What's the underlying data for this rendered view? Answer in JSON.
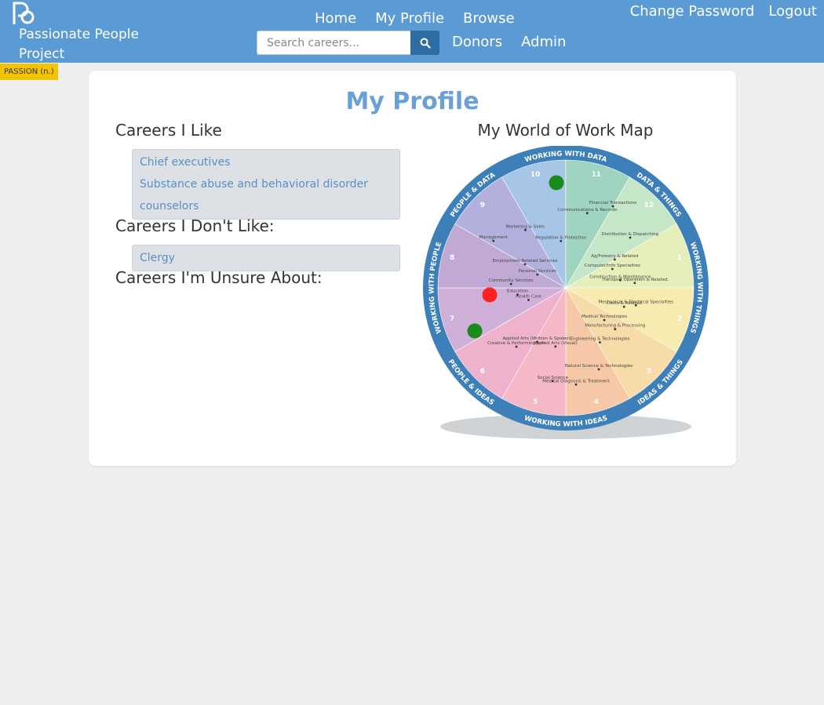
{
  "nav": {
    "brand": "Passionate People Project",
    "badge": "PASSION (n.)",
    "links_row1": [
      "Home",
      "My Profile",
      "Browse"
    ],
    "links_row2": [
      "Donors",
      "Admin"
    ],
    "right_links": [
      "Change Password",
      "Logout"
    ],
    "search_placeholder": "Search careers...",
    "colors": {
      "navbar": "#5b9bd5",
      "badge": "#f2c500",
      "search_button": "#2e6da4"
    }
  },
  "page": {
    "title": "My Profile",
    "liked_heading": "Careers I Like",
    "liked": [
      "Chief executives",
      "Substance abuse and behavioral disorder counselors"
    ],
    "disliked_heading": "Careers I Don't Like:",
    "disliked": [
      "Clergy"
    ],
    "unsure_heading": "Careers I'm Unsure About:",
    "unsure": [],
    "map_title": "My World of Work Map"
  },
  "wheel": {
    "ring_labels": [
      "WORKING WITH DATA",
      "DATA & THINGS",
      "WORKING WITH THINGS",
      "IDEAS & THINGS",
      "WORKING WITH IDEAS",
      "PEOPLE & IDEAS",
      "WORKING WITH PEOPLE",
      "PEOPLE & DATA"
    ],
    "region_numbers": [
      "1",
      "2",
      "3",
      "4",
      "5",
      "6",
      "7",
      "8",
      "9",
      "10",
      "11",
      "12"
    ],
    "career_labels": [
      "Financial Transactions",
      "Communications & Records",
      "Management",
      "Marketing & Sales",
      "Regulation & Protection",
      "Distribution & Dispatching",
      "Employment-Related Services",
      "Personal Services",
      "Transport Operation & Related",
      "Ag/Forestry & Related",
      "Computer/Info Specialties",
      "Construction & Maintenance",
      "Mechanical & Electrical Specialties",
      "Crafts & Related",
      "Community Services",
      "Education",
      "Health Care",
      "Manufacturing & Processing",
      "Medical Technologies",
      "Engineering & Technologies",
      "Applied Arts (Written & Spoken)",
      "Creative & Performing Arts",
      "Applied Arts (Visual)",
      "Natural Science & Technologies",
      "Social Science",
      "Medical Diagnosis & Treatment"
    ],
    "markers": [
      {
        "name": "liked-marker-1",
        "color": "#1a8a1a"
      },
      {
        "name": "disliked-marker",
        "color": "#ff2020"
      },
      {
        "name": "liked-marker-2",
        "color": "#1a8a1a"
      }
    ]
  }
}
